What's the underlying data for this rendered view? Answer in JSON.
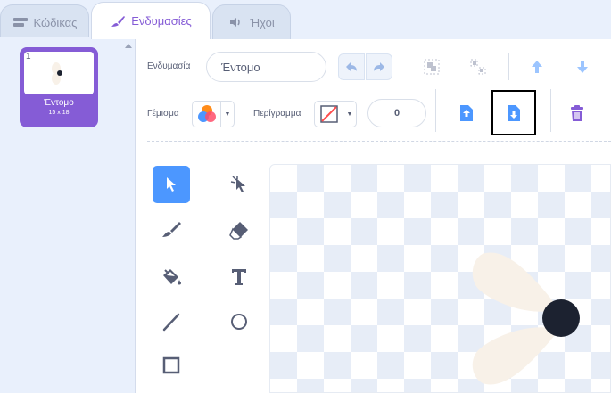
{
  "tabs": {
    "code_label": "Κώδικας",
    "costumes_label": "Ενδυμασίες",
    "sounds_label": "Ήχοι"
  },
  "costume_list": {
    "items": [
      {
        "number": "1",
        "name": "Έντομο",
        "size": "15 x 18"
      }
    ]
  },
  "toolbar": {
    "costume_label": "Ενδυμασία",
    "costume_name": "Έντομο",
    "fill_label": "Γέμισμα",
    "outline_label": "Περίγραμμα",
    "outline_width": "0"
  },
  "icons": {
    "undo": "undo-icon",
    "redo": "redo-icon",
    "group": "group-icon",
    "ungroup": "ungroup-icon",
    "forward": "forward-icon",
    "backward": "backward-icon",
    "front": "front-icon",
    "back": "back-icon",
    "delete": "trash-icon"
  },
  "colors": {
    "accent": "#855cd6",
    "tool_selected": "#4c97ff",
    "icon_blue": "#4c97ff",
    "text": "#575e75",
    "sprite_body": "#f8f1e8",
    "sprite_dot": "#1c2230"
  }
}
